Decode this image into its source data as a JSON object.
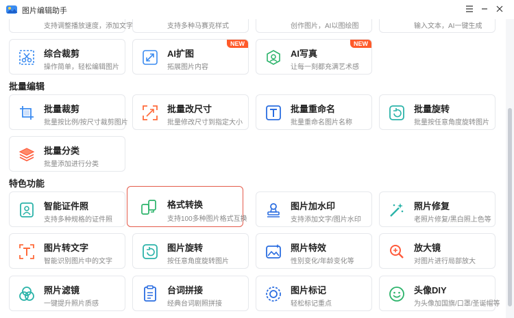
{
  "app": {
    "title": "图片编辑助手"
  },
  "colors": {
    "accent": "#2a6de0",
    "selected_border": "#e45a4a",
    "badge": "#ff5a2a"
  },
  "partial_top": [
    {
      "icon": "playback-icon",
      "desc": "支持调整播放速度，添加文字"
    },
    {
      "icon": "mosaic-icon",
      "desc": "支持多种马赛克样式"
    },
    {
      "icon": "ai-paint-icon",
      "desc": "创作图片，AI以图绘图"
    },
    {
      "icon": "ai-text-icon",
      "desc": "输入文本，AI一键生成"
    }
  ],
  "row_tools": [
    {
      "icon": "crop-icon",
      "title": "综合裁剪",
      "desc": "操作简单，轻松编辑图片",
      "badge": ""
    },
    {
      "icon": "expand-icon",
      "title": "AI扩图",
      "desc": "拓展图片内容",
      "badge": "NEW"
    },
    {
      "icon": "ai-portrait-icon",
      "title": "AI写真",
      "desc": "让每一刻都充满艺术感",
      "badge": "NEW"
    }
  ],
  "sections": {
    "batch": "批量编辑",
    "special": "特色功能"
  },
  "batch_tools": [
    {
      "icon": "batch-crop-icon",
      "title": "批量裁剪",
      "desc": "批量按比例/按尺寸裁剪图片"
    },
    {
      "icon": "batch-resize-icon",
      "title": "批量改尺寸",
      "desc": "批量修改尺寸到指定大小"
    },
    {
      "icon": "batch-rename-icon",
      "title": "批量重命名",
      "desc": "批量重命名图片名称"
    },
    {
      "icon": "batch-rotate-icon",
      "title": "批量旋转",
      "desc": "批量按任意角度旋转图片"
    },
    {
      "icon": "batch-classify-icon",
      "title": "批量分类",
      "desc": "批量添加进行分类"
    }
  ],
  "special_tools": [
    {
      "icon": "id-photo-icon",
      "title": "智能证件照",
      "desc": "支持多种规格的证件照"
    },
    {
      "icon": "format-convert-icon",
      "title": "格式转换",
      "desc": "支持100多种图片格式互换"
    },
    {
      "icon": "watermark-icon",
      "title": "图片加水印",
      "desc": "支持添加文字/图片水印"
    },
    {
      "icon": "photo-repair-icon",
      "title": "照片修复",
      "desc": "老照片修复/黑白照上色等"
    },
    {
      "icon": "ocr-text-icon",
      "title": "图片转文字",
      "desc": "智能识别图片中的文字"
    },
    {
      "icon": "image-rotate-icon",
      "title": "图片旋转",
      "desc": "按任意角度旋转图片"
    },
    {
      "icon": "photo-effect-icon",
      "title": "照片特效",
      "desc": "性别变化/年龄变化等"
    },
    {
      "icon": "magnifier-icon",
      "title": "放大镜",
      "desc": "对图片进行局部放大"
    },
    {
      "icon": "photo-filter-icon",
      "title": "照片滤镜",
      "desc": "一键提升照片质感"
    },
    {
      "icon": "lines-stitch-icon",
      "title": "台词拼接",
      "desc": "经典台词剧照拼接"
    },
    {
      "icon": "image-mark-icon",
      "title": "图片标记",
      "desc": "轻松标记重点"
    },
    {
      "icon": "avatar-diy-icon",
      "title": "头像DIY",
      "desc": "为头像加国旗/口罩/圣诞帽等"
    }
  ]
}
